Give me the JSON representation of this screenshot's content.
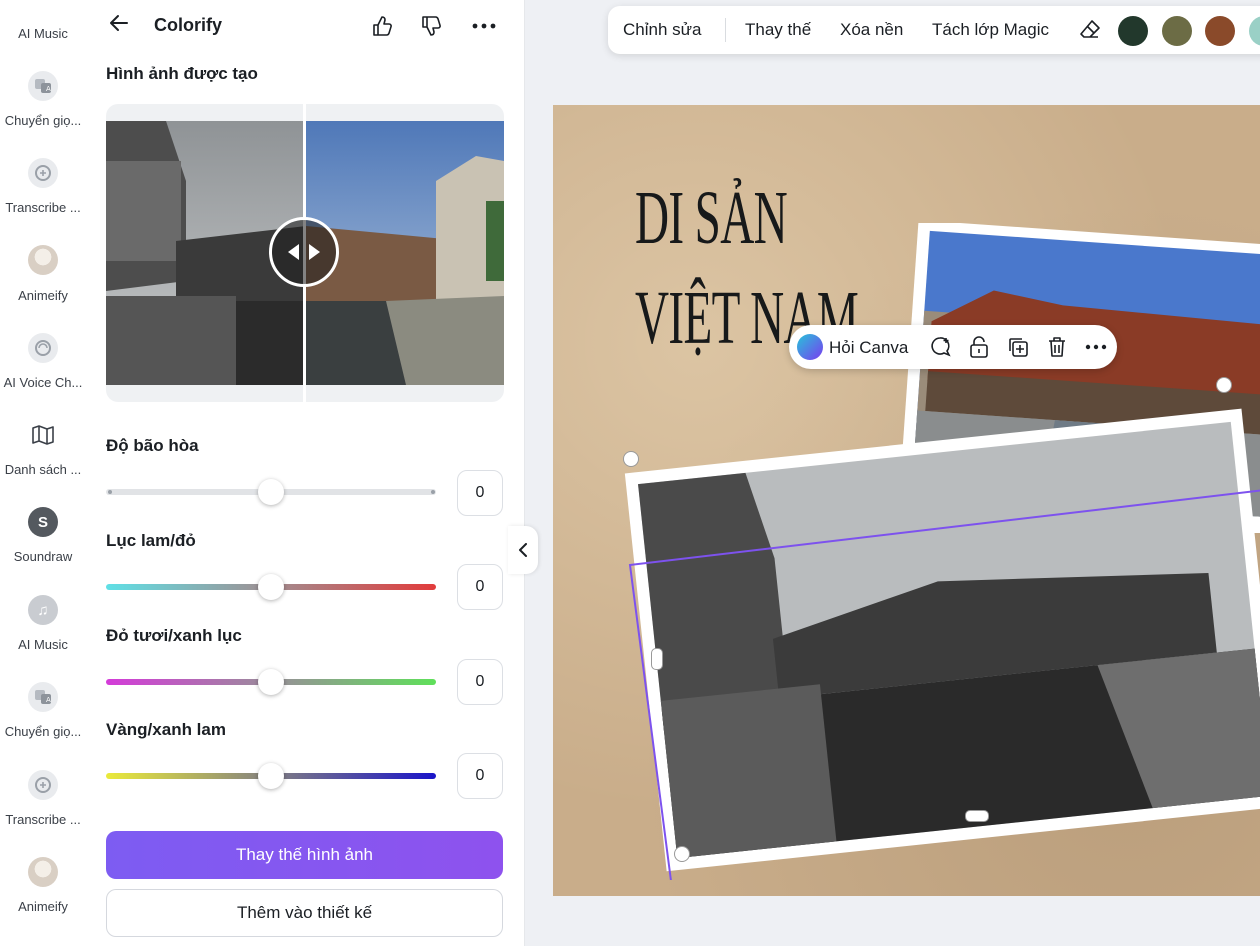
{
  "rail": {
    "items": [
      {
        "label": "AI Music",
        "icon": "music-note-icon"
      },
      {
        "label": "Chuyển giọ...",
        "icon": "translate-icon"
      },
      {
        "label": "Transcribe ...",
        "icon": "transcribe-icon"
      },
      {
        "label": "Animeify",
        "icon": "avatar-icon"
      },
      {
        "label": "AI Voice Ch...",
        "icon": "voice-change-icon"
      },
      {
        "label": "Danh sách ...",
        "icon": "map-icon"
      },
      {
        "label": "Soundraw",
        "icon": "soundraw-s-icon",
        "glyph": "S"
      },
      {
        "label": "AI Music",
        "icon": "music-note-icon",
        "glyph": "♫"
      },
      {
        "label": "Chuyển giọ...",
        "icon": "translate-icon"
      },
      {
        "label": "Transcribe ...",
        "icon": "transcribe-icon"
      },
      {
        "label": "Animeify",
        "icon": "avatar-icon"
      }
    ]
  },
  "panel": {
    "title": "Colorify",
    "section_title": "Hình ảnh được tạo",
    "sliders": [
      {
        "label": "Độ bão hòa",
        "value": "0",
        "gradient": [
          "#e1e3e6",
          "#e1e3e6"
        ]
      },
      {
        "label": "Lục lam/đỏ",
        "value": "0",
        "gradient": [
          "#5fe0e6",
          "#e23b3b"
        ]
      },
      {
        "label": "Đỏ tươi/xanh lục",
        "value": "0",
        "gradient": [
          "#d43bd9",
          "#5fe05a"
        ]
      },
      {
        "label": "Vàng/xanh lam",
        "value": "0",
        "gradient": [
          "#eaea3a",
          "#1a14c9"
        ]
      }
    ],
    "primary_button": "Thay thế hình ảnh",
    "secondary_button": "Thêm vào thiết kế"
  },
  "toolbar": {
    "edit": "Chỉnh sửa",
    "replace": "Thay thế",
    "remove_bg": "Xóa nền",
    "magic_layer": "Tách lớp Magic",
    "swatches": [
      "#22382c",
      "#6c6c45",
      "#8a4a2a",
      "#9ad0c6"
    ]
  },
  "canvas": {
    "heading_line1": "DI SẢN",
    "heading_line2": "VIỆT NAM",
    "float_menu_label": "Hỏi Canva"
  }
}
